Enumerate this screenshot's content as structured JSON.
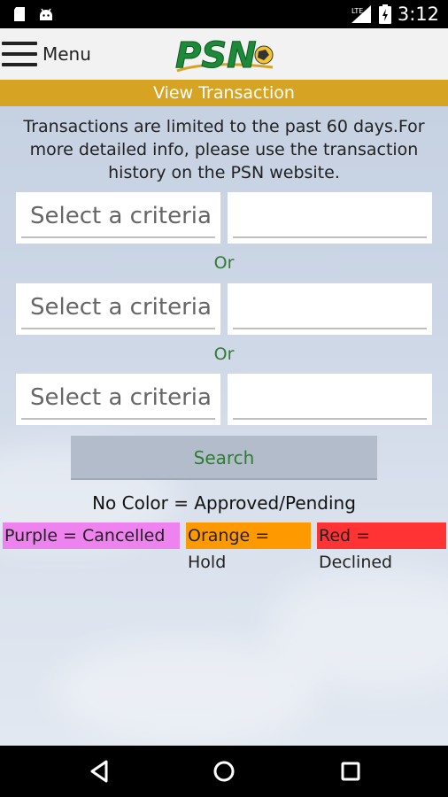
{
  "status_bar": {
    "time": "3:12",
    "network": "LTE",
    "left_icons": [
      "sd-card-icon",
      "android-icon"
    ]
  },
  "header": {
    "menu_label": "Menu",
    "logo_text": "PSN"
  },
  "title_bar": {
    "title": "View Transaction",
    "color": "#d7a323"
  },
  "notice": {
    "text": "Transactions are limited to the past 60 days.For more detailed info, please use the transaction history on the PSN website."
  },
  "criteria_rows": [
    {
      "select_placeholder": "Select a criteria",
      "value": ""
    },
    {
      "select_placeholder": "Select a criteria",
      "value": ""
    },
    {
      "select_placeholder": "Select a criteria",
      "value": ""
    }
  ],
  "or_labels": [
    "Or",
    "Or"
  ],
  "search_button": {
    "label": "Search"
  },
  "legend": {
    "title": "No Color = Approved/Pending",
    "items": [
      {
        "label": "Purple = Cancelled",
        "color": "#ee82ee"
      },
      {
        "label": "Orange = Hold",
        "color": "#ff9900"
      },
      {
        "label": "Red = Declined",
        "color": "#ff3333"
      }
    ]
  },
  "nav_bar": {
    "icons": [
      "back-icon",
      "home-icon",
      "recents-icon"
    ]
  }
}
